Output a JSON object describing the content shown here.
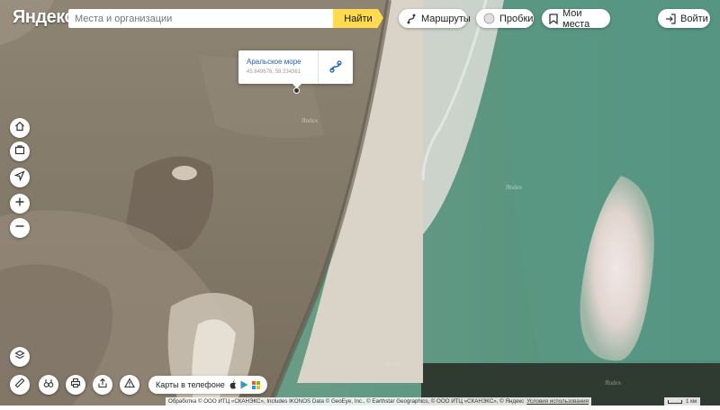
{
  "header": {
    "logo_text": "Яндекс",
    "search_placeholder": "Места и организации",
    "search_button": "Найти",
    "routes_label": "Маршруты",
    "traffic_label": "Пробки",
    "my_places_label": "Мои места",
    "login_label": "Войти"
  },
  "popup": {
    "title": "Аральское море",
    "coords": "45.849676, 59.334361"
  },
  "map_labels": {
    "watermark": "Яndex"
  },
  "bottom": {
    "phone_label": "Карты в телефоне",
    "attribution": "Обработка © ООО ИТЦ «СКАНЭКС», Includes IKONOS Data © GeoEye, Inc., © Earthstar Geographics, © ООО ИТЦ «СКАНЭКС», © Яндекс",
    "terms_link": "Условия использования",
    "scale_label": "1 км"
  },
  "colors": {
    "accent": "#ffdb4d",
    "link": "#1a5fb4",
    "land": "#8a7d6c",
    "beach": "#d9d3c8",
    "water": "#5f9a86"
  }
}
